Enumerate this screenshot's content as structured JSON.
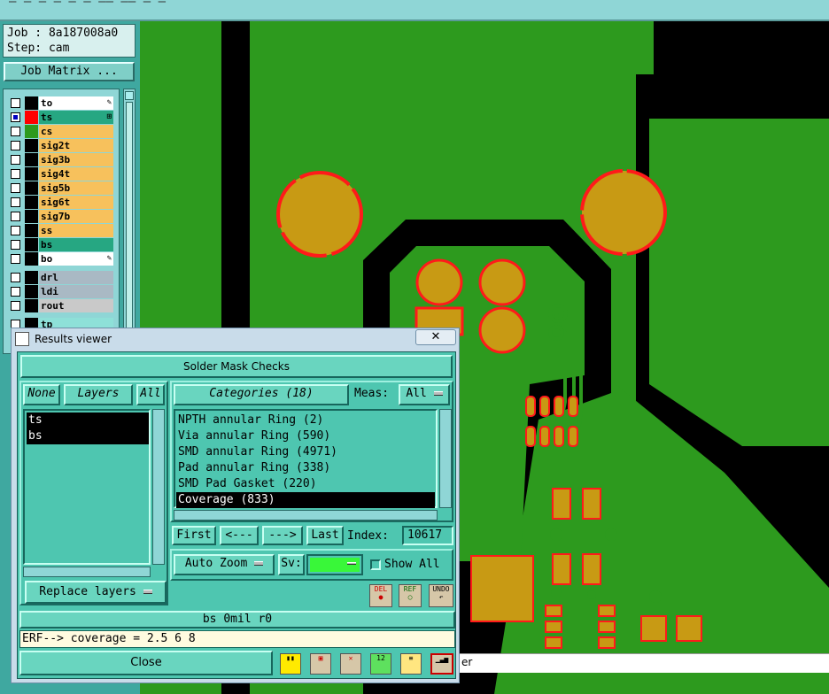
{
  "top_strip": {
    "text": "— — —  —   —    —  ——  —— — —"
  },
  "left_panel": {
    "job_label": "Job : 8a187008a0",
    "step_label": "Step: cam",
    "job_matrix_button": "Job Matrix ...",
    "layers": [
      {
        "name": "to",
        "bg": "#ffffff",
        "swatch": "#000000",
        "checked": false,
        "mark": "pencil"
      },
      {
        "name": "ts",
        "bg": "#26a782",
        "swatch": "#ff0000",
        "checked": true,
        "mark": "grid"
      },
      {
        "name": "cs",
        "bg": "#f7c15c",
        "swatch": "#2d9a1e",
        "checked": false,
        "mark": ""
      },
      {
        "name": "sig2t",
        "bg": "#f7c15c",
        "swatch": "",
        "checked": false,
        "mark": ""
      },
      {
        "name": "sig3b",
        "bg": "#f7c15c",
        "swatch": "",
        "checked": false,
        "mark": ""
      },
      {
        "name": "sig4t",
        "bg": "#f7c15c",
        "swatch": "",
        "checked": false,
        "mark": ""
      },
      {
        "name": "sig5b",
        "bg": "#f7c15c",
        "swatch": "",
        "checked": false,
        "mark": ""
      },
      {
        "name": "sig6t",
        "bg": "#f7c15c",
        "swatch": "",
        "checked": false,
        "mark": ""
      },
      {
        "name": "sig7b",
        "bg": "#f7c15c",
        "swatch": "",
        "checked": false,
        "mark": ""
      },
      {
        "name": "ss",
        "bg": "#f7c15c",
        "swatch": "",
        "checked": false,
        "mark": ""
      },
      {
        "name": "bs",
        "bg": "#26a782",
        "swatch": "",
        "checked": false,
        "mark": ""
      },
      {
        "name": "bo",
        "bg": "#ffffff",
        "swatch": "",
        "checked": false,
        "mark": "pencil"
      },
      {
        "name": "drl",
        "bg": "#a9b9c4",
        "swatch": "",
        "checked": false,
        "mark": ""
      },
      {
        "name": "ldi",
        "bg": "#a9b9c4",
        "swatch": "",
        "checked": false,
        "mark": ""
      },
      {
        "name": "rout",
        "bg": "#c9c9c9",
        "swatch": "",
        "checked": false,
        "mark": ""
      },
      {
        "name": "tp",
        "bg": "#8ee0d8",
        "swatch": "",
        "checked": false,
        "mark": ""
      }
    ]
  },
  "results_viewer": {
    "window_title": "Results viewer",
    "header": "Solder Mask Checks",
    "none_button": "None",
    "layers_label": "Layers",
    "all_button": "All",
    "layer_items": [
      {
        "name": "ts",
        "selected": true
      },
      {
        "name": "bs",
        "selected": true
      }
    ],
    "categories_label": "Categories (18)",
    "meas_label": "Meas:",
    "meas_value": "All",
    "categories": [
      {
        "label": "NPTH annular Ring (2)",
        "selected": false
      },
      {
        "label": "Via annular Ring (590)",
        "selected": false
      },
      {
        "label": "SMD annular Ring (4971)",
        "selected": false
      },
      {
        "label": "Pad annular Ring (338)",
        "selected": false
      },
      {
        "label": "SMD Pad Gasket (220)",
        "selected": false
      },
      {
        "label": "Coverage (833)",
        "selected": true
      }
    ],
    "nav": {
      "first": "First",
      "prev": "<---",
      "next": "--->",
      "last": "Last",
      "index_label": "Index:",
      "index_value": "10617"
    },
    "auto_zoom": "Auto Zoom",
    "sv_label": "Sv:",
    "show_all_label": "Show All",
    "replace_layers": "Replace layers",
    "icon_del": "DEL",
    "icon_ref": "REF",
    "icon_undo": "UNDO",
    "status": "bs  0mil  r0",
    "erf_line": "ERF--> coverage = 2.5 6 8",
    "close_button": "Close"
  },
  "behind_text": "er",
  "colors": {
    "board_green": "#2d9a1e",
    "copper": "#c89a14",
    "mask_red": "#ff1a1a",
    "panel_teal": "#4ec6b0",
    "sv_green": "#39f739"
  }
}
